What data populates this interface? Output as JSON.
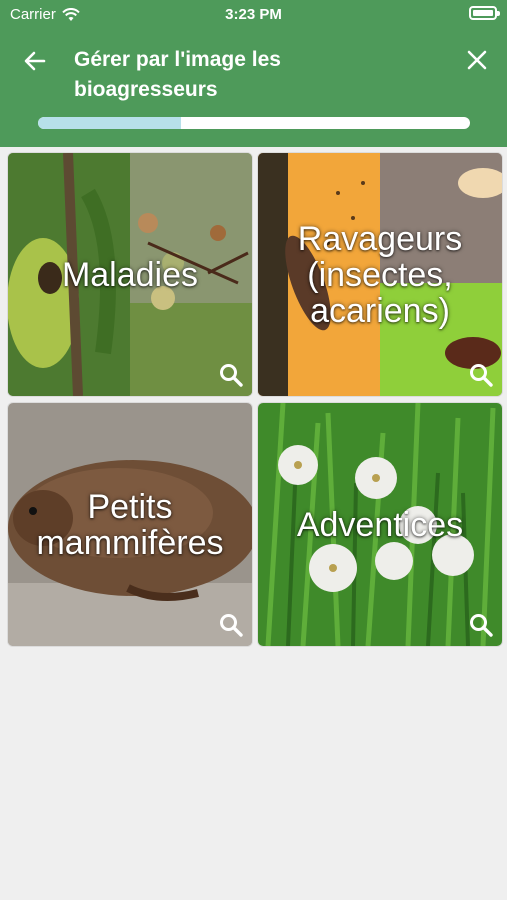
{
  "status_bar": {
    "carrier": "Carrier",
    "time": "3:23 PM"
  },
  "header": {
    "title": "Gérer par l'image les bioagresseurs",
    "progress": 0.33,
    "bg_color": "#4e9a5a"
  },
  "categories": [
    {
      "label": "Maladies",
      "icon": "search-icon"
    },
    {
      "label": "Ravageurs (insectes, acariens)",
      "icon": "search-icon"
    },
    {
      "label": "Petits mammifères",
      "icon": "search-icon"
    },
    {
      "label": "Adventices",
      "icon": "search-icon"
    }
  ]
}
